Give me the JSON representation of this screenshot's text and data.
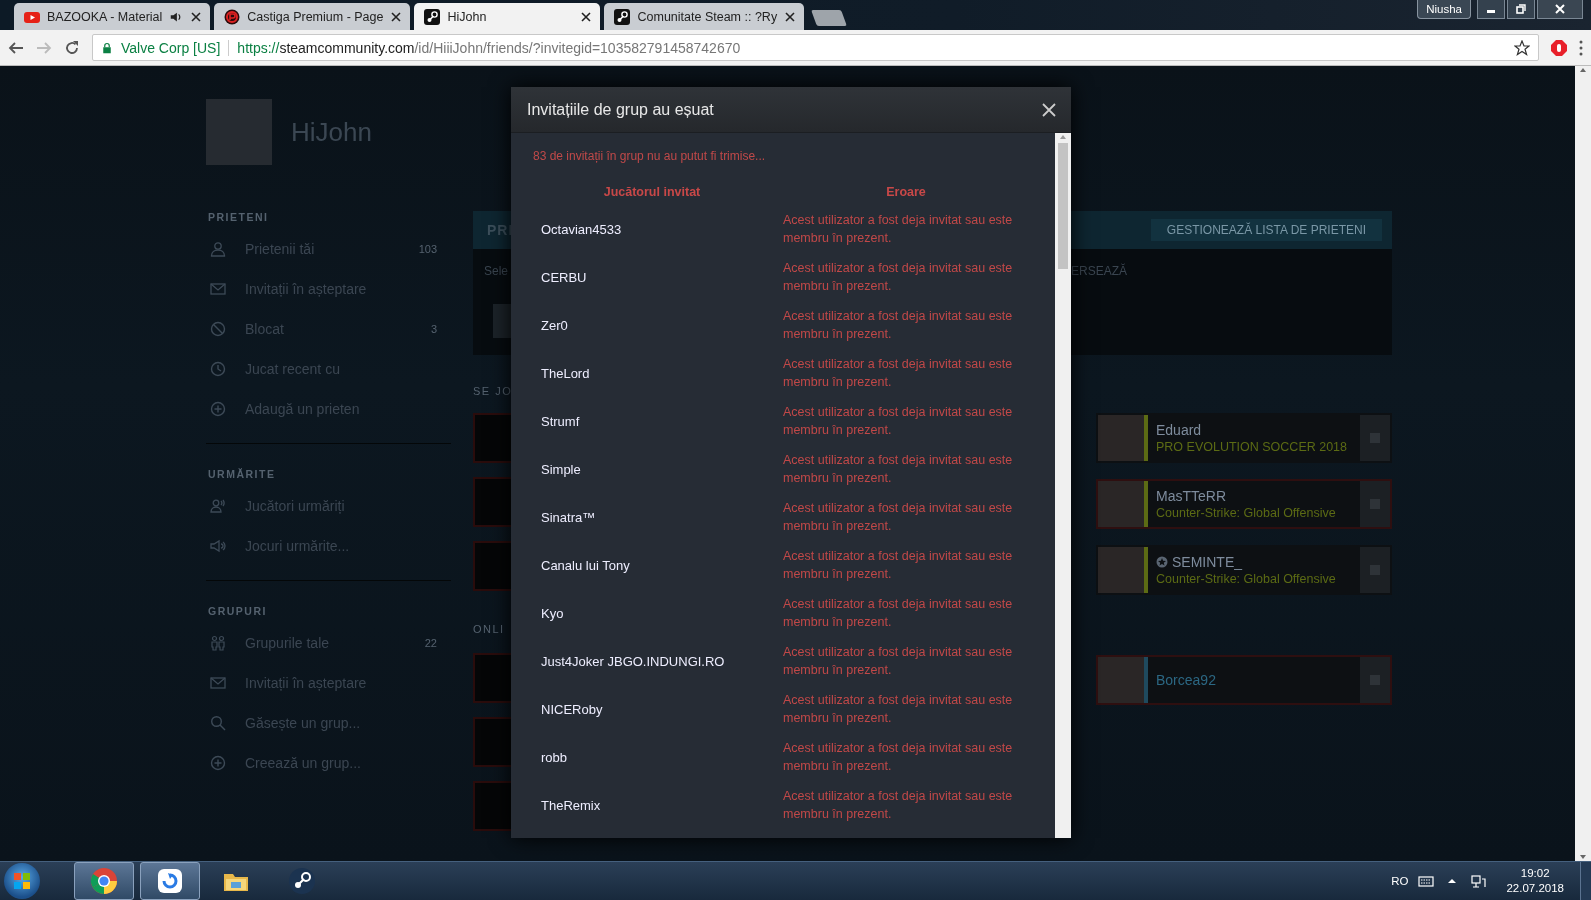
{
  "browser": {
    "tabs": [
      {
        "title": "BAZOOKA - Material",
        "selected": false,
        "playing_audio": true
      },
      {
        "title": "Castiga Premium - Page",
        "selected": false,
        "playing_audio": false
      },
      {
        "title": "HiJohn",
        "selected": true,
        "playing_audio": false
      },
      {
        "title": "Comunitate Steam :: ?Ry",
        "selected": false,
        "playing_audio": false
      }
    ],
    "profile_name": "Niusha",
    "address": {
      "security_label": "Valve Corp [US]",
      "scheme": "https://",
      "host": "steamcommunity.com",
      "path": "/id/HiiiJohn/friends/?invitegid=103582791458742670"
    }
  },
  "profile": {
    "name": "HiJohn"
  },
  "sidebar": {
    "sections": [
      {
        "title": "PRIETENI",
        "items": [
          {
            "label": "Prietenii tăi",
            "count": "103"
          },
          {
            "label": "Invitații în așteptare"
          },
          {
            "label": "Blocat",
            "count": "3"
          },
          {
            "label": "Jucat recent cu"
          },
          {
            "label": "Adaugă un prieten"
          }
        ]
      },
      {
        "title": "URMĂRITE",
        "items": [
          {
            "label": "Jucători urmăriți"
          },
          {
            "label": "Jocuri urmărite..."
          }
        ]
      },
      {
        "title": "GRUPURI",
        "items": [
          {
            "label": "Grupurile tale",
            "count": "22"
          },
          {
            "label": "Invitații în așteptare"
          },
          {
            "label": "Găsește un grup..."
          },
          {
            "label": "Creează un grup..."
          }
        ]
      }
    ]
  },
  "friends_panel": {
    "header": "PRI",
    "manage_button": "GESTIONEAZĂ LISTA DE PRIETENI",
    "text_left": "Sele",
    "text_right": "ERSEAZĂ"
  },
  "section_labels": [
    "SE JO",
    "ONLI"
  ],
  "friend_cards": [
    {
      "name": "Eduard",
      "game": "PRO EVOLUTION SOCCER 2018",
      "color": "#5c6b14",
      "favorite": false,
      "outlined": false,
      "checked": false
    },
    {
      "name": "MasTTeRR",
      "game": "Counter-Strike: Global Offensive",
      "color": "#5c6b14",
      "favorite": false,
      "outlined": true,
      "checked": false
    },
    {
      "name": "SEMINTE_",
      "game": "Counter-Strike: Global Offensive",
      "color": "#5c6b14",
      "favorite": true,
      "outlined": false,
      "checked": false
    },
    {
      "name": "Borcea92",
      "color": "#1f4a5e",
      "favorite": false,
      "outlined": true,
      "checked": false
    }
  ],
  "dialog": {
    "title": "Invitațiile de grup au eșuat",
    "message": "83 de invitații în grup nu au putut fi trimise...",
    "columns": [
      "Jucătorul invitat",
      "Eroare"
    ],
    "rows": [
      {
        "player": "Octavian4533",
        "error": "Acest utilizator a fost deja invitat sau este membru în prezent."
      },
      {
        "player": "CERBU",
        "error": "Acest utilizator a fost deja invitat sau este membru în prezent."
      },
      {
        "player": "Zer0",
        "error": "Acest utilizator a fost deja invitat sau este membru în prezent."
      },
      {
        "player": "TheLord",
        "error": "Acest utilizator a fost deja invitat sau este membru în prezent."
      },
      {
        "player": "Strumf",
        "error": "Acest utilizator a fost deja invitat sau este membru în prezent."
      },
      {
        "player": "Simple",
        "error": "Acest utilizator a fost deja invitat sau este membru în prezent."
      },
      {
        "player": "Sinatra™",
        "error": "Acest utilizator a fost deja invitat sau este membru în prezent."
      },
      {
        "player": "Canalu lui Tony",
        "error": "Acest utilizator a fost deja invitat sau este membru în prezent."
      },
      {
        "player": "Kyo",
        "error": "Acest utilizator a fost deja invitat sau este membru în prezent."
      },
      {
        "player": "Just4Joker JBGO.INDUNGI.RO",
        "error": "Acest utilizator a fost deja invitat sau este membru în prezent."
      },
      {
        "player": "NICERoby",
        "error": "Acest utilizator a fost deja invitat sau este membru în prezent."
      },
      {
        "player": "robb",
        "error": "Acest utilizator a fost deja invitat sau este membru în prezent."
      },
      {
        "player": "TheRemix",
        "error": "Acest utilizator a fost deja invitat sau este membru în prezent."
      }
    ]
  },
  "taskbar": {
    "apps": [
      {
        "running": true
      },
      {
        "running": true
      },
      {
        "running": false
      },
      {
        "running": false
      }
    ],
    "language": "RO",
    "time": "19:02",
    "date": "22.07.2018"
  }
}
